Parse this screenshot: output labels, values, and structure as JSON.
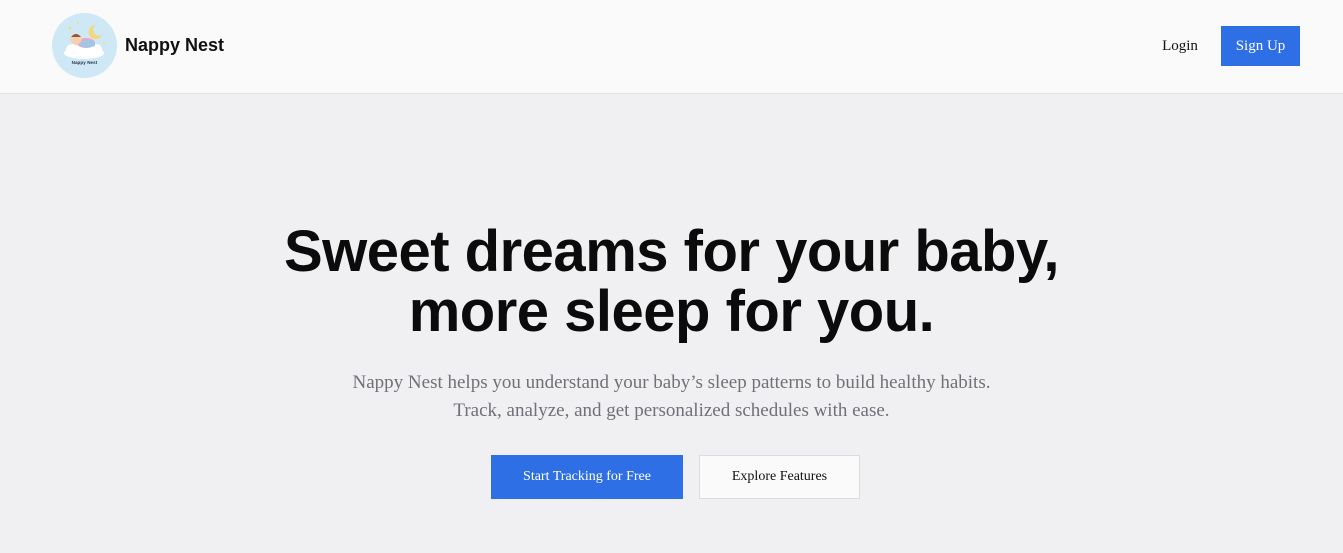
{
  "header": {
    "brand_name": "Nappy Nest",
    "logo_text": "Nappy Nest",
    "nav": {
      "login_label": "Login",
      "signup_label": "Sign Up"
    }
  },
  "hero": {
    "title_line1": "Sweet dreams for your baby,",
    "title_line2": "more sleep for you.",
    "subtitle_line1": "Nappy Nest helps you understand your baby’s sleep patterns to build healthy habits.",
    "subtitle_line2": "Track, analyze, and get personalized schedules with ease.",
    "primary_cta": "Start Tracking for Free",
    "secondary_cta": "Explore Features"
  },
  "colors": {
    "accent": "#2f6fe6",
    "page_bg": "#f0f0f2",
    "header_bg": "#fafafa",
    "logo_bg": "#cfe8f6"
  },
  "icons": {
    "logo": "sleeping-baby-on-cloud-logo"
  }
}
